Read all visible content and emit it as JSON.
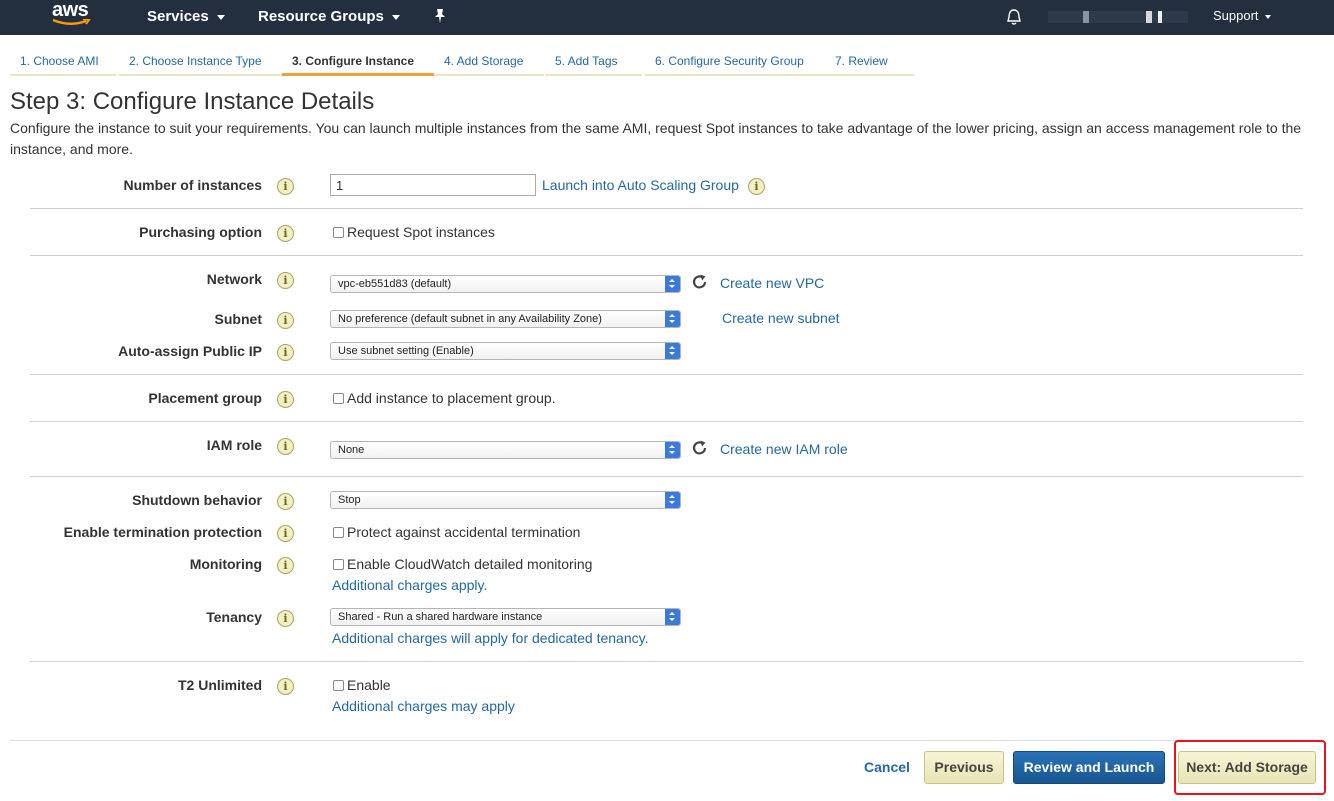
{
  "nav": {
    "logo": "aws",
    "services": "Services",
    "resource_groups": "Resource Groups",
    "support": "Support",
    "pin_icon": "pin-icon",
    "bell_icon": "bell-icon"
  },
  "wizard": {
    "tabs": [
      "1. Choose AMI",
      "2. Choose Instance Type",
      "3. Configure Instance",
      "4. Add Storage",
      "5. Add Tags",
      "6. Configure Security Group",
      "7. Review"
    ],
    "active_tab": 2
  },
  "page": {
    "title": "Step 3: Configure Instance Details",
    "description": "Configure the instance to suit your requirements. You can launch multiple instances from the same AMI, request Spot instances to take advantage of the lower pricing, assign an access management role to the instance, and more."
  },
  "form": {
    "number_of_instances": {
      "label": "Number of instances",
      "value": "1",
      "link": "Launch into Auto Scaling Group"
    },
    "purchasing_option": {
      "label": "Purchasing option",
      "checkbox": "Request Spot instances",
      "checked": false
    },
    "network": {
      "label": "Network",
      "value": "vpc-eb551d83 (default)",
      "link": "Create new VPC"
    },
    "subnet": {
      "label": "Subnet",
      "value": "No preference (default subnet in any Availability Zone)",
      "link": "Create new subnet"
    },
    "auto_assign_ip": {
      "label": "Auto-assign Public IP",
      "value": "Use subnet setting (Enable)"
    },
    "placement_group": {
      "label": "Placement group",
      "checkbox": "Add instance to placement group.",
      "checked": false
    },
    "iam_role": {
      "label": "IAM role",
      "value": "None",
      "link": "Create new IAM role"
    },
    "shutdown_behavior": {
      "label": "Shutdown behavior",
      "value": "Stop"
    },
    "termination_protection": {
      "label": "Enable termination protection",
      "checkbox": "Protect against accidental termination",
      "checked": false
    },
    "monitoring": {
      "label": "Monitoring",
      "checkbox": "Enable CloudWatch detailed monitoring",
      "checked": false,
      "note": "Additional charges apply."
    },
    "tenancy": {
      "label": "Tenancy",
      "value": "Shared - Run a shared hardware instance",
      "note": "Additional charges will apply for dedicated tenancy."
    },
    "t2_unlimited": {
      "label": "T2 Unlimited",
      "checkbox": "Enable",
      "checked": false,
      "note": "Additional charges may apply"
    }
  },
  "footer": {
    "cancel": "Cancel",
    "previous": "Previous",
    "review_launch": "Review and Launch",
    "next": "Next: Add Storage"
  },
  "colors": {
    "nav_bg": "#232f3e",
    "link": "#2468a2",
    "primary_button": "#1f66a7",
    "highlight": "#e8141c",
    "active_tab_underline": "#e8a33d"
  }
}
